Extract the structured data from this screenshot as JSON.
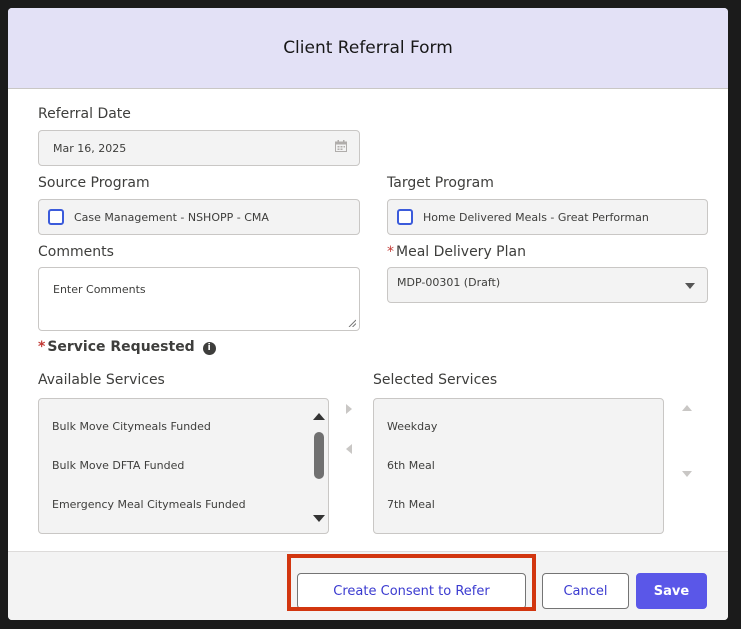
{
  "modal": {
    "title": "Client Referral Form"
  },
  "form": {
    "referral_date": {
      "label": "Referral Date",
      "value": "Mar 16, 2025"
    },
    "source_program": {
      "label": "Source Program",
      "value": "Case Management - NSHOPP - CMA"
    },
    "target_program": {
      "label": "Target Program",
      "value": "Home Delivered Meals - Great Performan"
    },
    "comments": {
      "label": "Comments",
      "placeholder": "Enter Comments"
    },
    "meal_delivery_plan": {
      "label": "Meal Delivery Plan",
      "value": "MDP-00301 (Draft)",
      "required_marker": "*"
    },
    "service_requested": {
      "label": "Service Requested",
      "required_marker": "*",
      "info_icon": "i"
    },
    "available_services": {
      "label": "Available Services",
      "items": [
        "Bulk Move Citymeals Funded",
        "Bulk Move DFTA Funded",
        "Emergency Meal Citymeals Funded"
      ]
    },
    "selected_services": {
      "label": "Selected Services",
      "items": [
        "Weekday",
        "6th Meal",
        "7th Meal"
      ]
    }
  },
  "footer": {
    "create_consent_label": "Create Consent to Refer",
    "cancel_label": "Cancel",
    "save_label": "Save"
  },
  "colors": {
    "header_bg": "#e3e1f6",
    "brand": "#5a57e8",
    "highlight": "#d2360f",
    "required": "#c23934"
  }
}
